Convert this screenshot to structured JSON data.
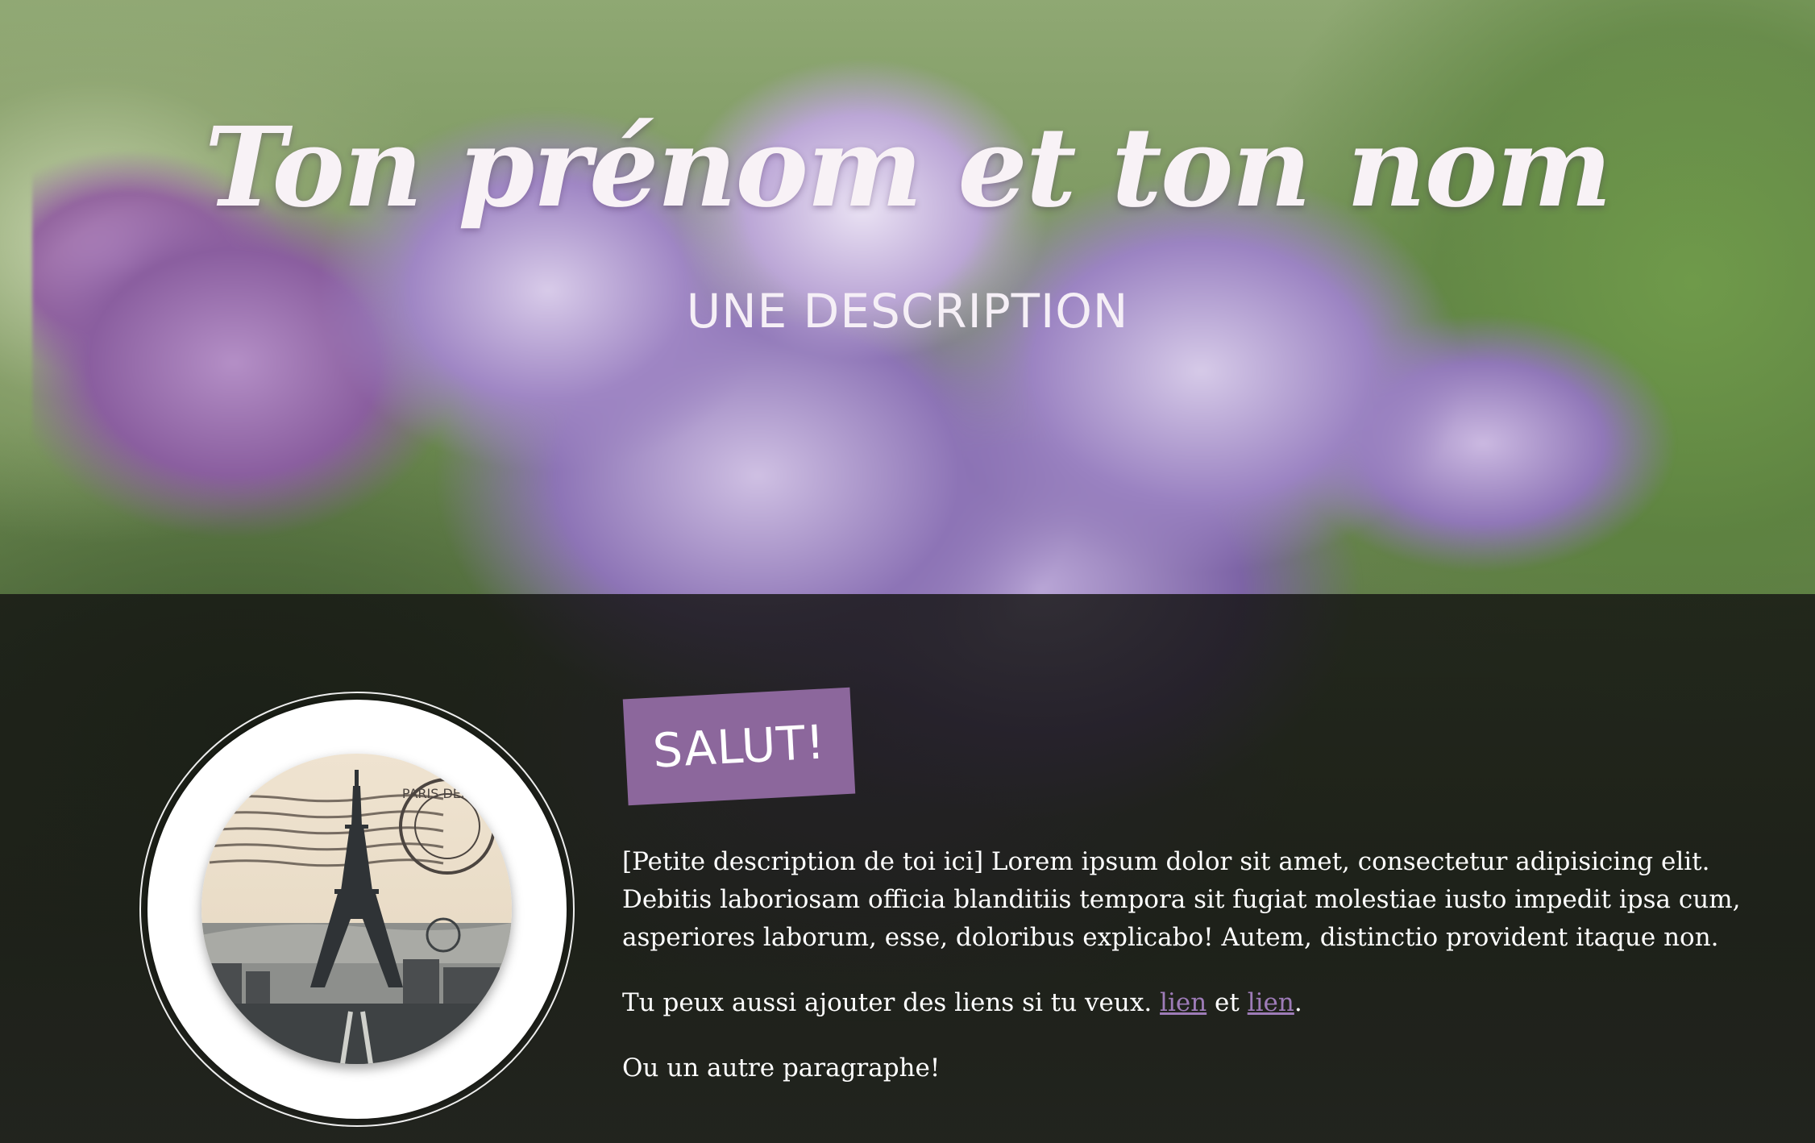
{
  "hero": {
    "title": "Ton prénom et ton nom",
    "subtitle": "UNE DESCRIPTION"
  },
  "avatar": {
    "icon": "eiffel-tower-postcard-stamp",
    "postmark_text": "PARIS DEPART"
  },
  "about": {
    "badge_label": "SALUT!",
    "paragraph1": "[Petite description de toi ici] Lorem ipsum dolor sit amet, consectetur adipisicing elit. Debitis laboriosam officia blanditiis tempora sit fugiat molestiae iusto impedit ipsa cum, asperiores laborum, esse, doloribus explicabo! Autem, distinctio provident itaque non.",
    "paragraph2_prefix": "Tu peux aussi ajouter des liens si tu veux. ",
    "link1": "lien",
    "paragraph2_middle": " et ",
    "link2": "lien",
    "paragraph2_suffix": ".",
    "paragraph3": "Ou un autre paragraphe!"
  },
  "colors": {
    "accent": "#8c679c",
    "link": "#9e7cb8",
    "text": "#ffffff"
  }
}
